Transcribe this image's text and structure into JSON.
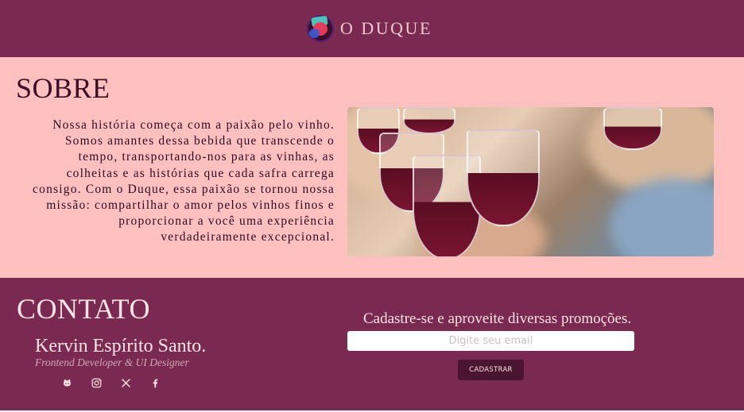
{
  "header": {
    "brand_name": "O DUQUE",
    "logo_icon": "wine-logo-icon"
  },
  "about": {
    "title": "SOBRE",
    "text": "Nossa história começa com a paixão pelo vinho. Somos amantes dessa bebida que transcende o tempo, transportando-nos para as vinhas, as colheitas e as histórias que cada safra carrega consigo. Com o Duque, essa paixão se tornou nossa missão: compartilhar o amor pelos vinhos finos e proporcionar a você uma experiência verdadeiramente excepcional."
  },
  "contact": {
    "title": "CONTATO",
    "person_name": "Kervin Espírito Santo.",
    "person_role": "Frontend Developer & UI Designer",
    "socials": [
      "github-icon",
      "instagram-icon",
      "x-icon",
      "facebook-icon"
    ],
    "promo_text": "Cadastre-se e aproveite diversas promoções.",
    "email_placeholder": "Digite seu email",
    "submit_label": "CADASTRAR"
  },
  "colors": {
    "header_bg": "#7a2950",
    "about_bg": "#ffc0bf",
    "contact_bg": "#7a2950",
    "button_bg": "#4a1530"
  }
}
